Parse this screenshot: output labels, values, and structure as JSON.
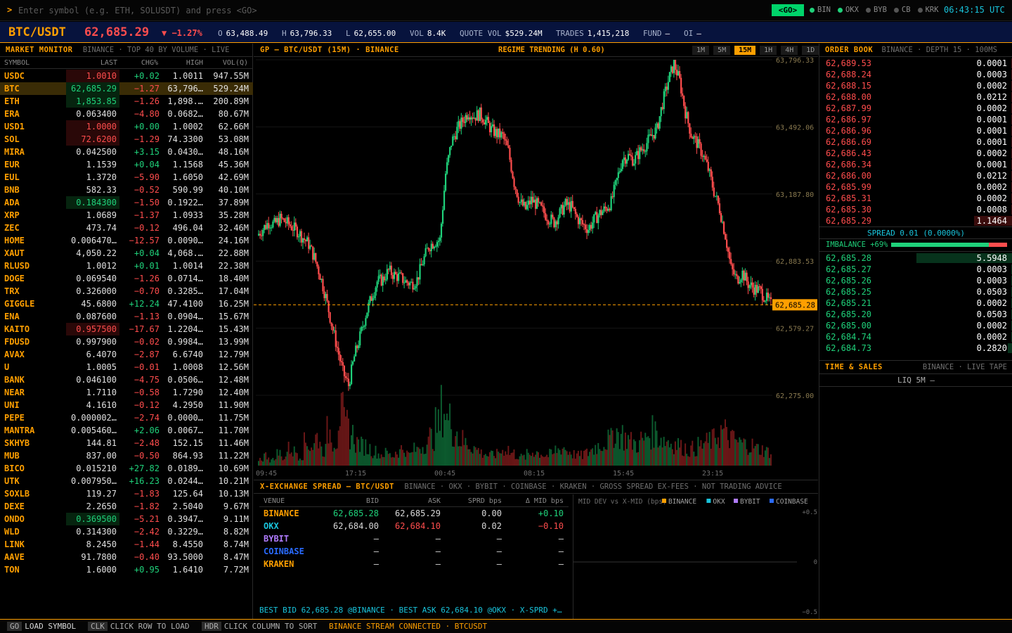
{
  "command": {
    "prompt": ">",
    "placeholder": "Enter symbol (e.g. ETH, SOLUSDT) and press <GO>",
    "go_label": "<GO>"
  },
  "exchanges": [
    {
      "code": "BIN",
      "color": "#1fd17a"
    },
    {
      "code": "OKX",
      "color": "#1fd17a"
    },
    {
      "code": "BYB",
      "color": "#555555"
    },
    {
      "code": "CB",
      "color": "#555555"
    },
    {
      "code": "KRK",
      "color": "#555555"
    }
  ],
  "clock": "06:43:15 UTC",
  "ticker": {
    "symbol": "BTC/USDT",
    "price": "62,685.29",
    "change": "▼ −1.27%",
    "open_label": "O",
    "open": "63,488.49",
    "high_label": "H",
    "high": "63,796.33",
    "low_label": "L",
    "low": "62,655.00",
    "vol_label": "VOL",
    "vol": "8.4K",
    "quote_vol_label": "QUOTE VOL",
    "quote_vol": "$529.24M",
    "trades_label": "TRADES",
    "trades": "1,415,218",
    "fund_label": "FUND",
    "fund": "—",
    "oi_label": "OI",
    "oi": "—"
  },
  "market_monitor": {
    "title": "MARKET MONITOR",
    "subtitle": "BINANCE · TOP 40 BY VOLUME · LIVE",
    "columns": [
      "SYMBOL",
      "LAST",
      "CHG%",
      "HIGH",
      "VOL(Q)"
    ],
    "rows": [
      {
        "sym": "USDC",
        "last": "1.0010",
        "chg": "+0.02",
        "high": "1.0011",
        "vol": "947.55M",
        "dir": "up",
        "flash": "dn"
      },
      {
        "sym": "BTC",
        "last": "62,685.29",
        "chg": "−1.27",
        "high": "63,796…",
        "vol": "529.24M",
        "dir": "dn",
        "flash": "up",
        "selected": true
      },
      {
        "sym": "ETH",
        "last": "1,853.85",
        "chg": "−1.26",
        "high": "1,898.…",
        "vol": "200.89M",
        "dir": "dn",
        "flash": "up"
      },
      {
        "sym": "ERA",
        "last": "0.063400",
        "chg": "−4.80",
        "high": "0.0682…",
        "vol": "80.67M",
        "dir": "dn",
        "flash": ""
      },
      {
        "sym": "USD1",
        "last": "1.0000",
        "chg": "+0.00",
        "high": "1.0002",
        "vol": "62.66M",
        "dir": "up",
        "flash": "dn"
      },
      {
        "sym": "SOL",
        "last": "72.6200",
        "chg": "−1.29",
        "high": "74.3300",
        "vol": "53.08M",
        "dir": "dn",
        "flash": "dn"
      },
      {
        "sym": "MIRA",
        "last": "0.042500",
        "chg": "+3.15",
        "high": "0.0430…",
        "vol": "48.16M",
        "dir": "up",
        "flash": ""
      },
      {
        "sym": "EUR",
        "last": "1.1539",
        "chg": "+0.04",
        "high": "1.1568",
        "vol": "45.36M",
        "dir": "up",
        "flash": ""
      },
      {
        "sym": "EUL",
        "last": "1.3720",
        "chg": "−5.90",
        "high": "1.6050",
        "vol": "42.69M",
        "dir": "dn",
        "flash": ""
      },
      {
        "sym": "BNB",
        "last": "582.33",
        "chg": "−0.52",
        "high": "590.99",
        "vol": "40.10M",
        "dir": "dn",
        "flash": ""
      },
      {
        "sym": "ADA",
        "last": "0.184300",
        "chg": "−1.50",
        "high": "0.1922…",
        "vol": "37.89M",
        "dir": "dn",
        "flash": "up"
      },
      {
        "sym": "XRP",
        "last": "1.0689",
        "chg": "−1.37",
        "high": "1.0933",
        "vol": "35.28M",
        "dir": "dn",
        "flash": ""
      },
      {
        "sym": "ZEC",
        "last": "473.74",
        "chg": "−0.12",
        "high": "496.04",
        "vol": "32.46M",
        "dir": "dn",
        "flash": ""
      },
      {
        "sym": "HOME",
        "last": "0.006470…",
        "chg": "−12.57",
        "high": "0.0090…",
        "vol": "24.16M",
        "dir": "dn",
        "flash": ""
      },
      {
        "sym": "XAUT",
        "last": "4,050.22",
        "chg": "+0.04",
        "high": "4,068.…",
        "vol": "22.88M",
        "dir": "up",
        "flash": ""
      },
      {
        "sym": "RLUSD",
        "last": "1.0012",
        "chg": "+0.01",
        "high": "1.0014",
        "vol": "22.38M",
        "dir": "up",
        "flash": ""
      },
      {
        "sym": "DOGE",
        "last": "0.069540",
        "chg": "−1.26",
        "high": "0.0714…",
        "vol": "18.40M",
        "dir": "dn",
        "flash": ""
      },
      {
        "sym": "TRX",
        "last": "0.326000",
        "chg": "−0.70",
        "high": "0.3285…",
        "vol": "17.04M",
        "dir": "dn",
        "flash": ""
      },
      {
        "sym": "GIGGLE",
        "last": "45.6800",
        "chg": "+12.24",
        "high": "47.4100",
        "vol": "16.25M",
        "dir": "up",
        "flash": ""
      },
      {
        "sym": "ENA",
        "last": "0.087600",
        "chg": "−1.13",
        "high": "0.0904…",
        "vol": "15.67M",
        "dir": "dn",
        "flash": ""
      },
      {
        "sym": "KAITO",
        "last": "0.957500",
        "chg": "−17.67",
        "high": "1.2204…",
        "vol": "15.43M",
        "dir": "dn",
        "flash": "dn"
      },
      {
        "sym": "FDUSD",
        "last": "0.997900",
        "chg": "−0.02",
        "high": "0.9984…",
        "vol": "13.99M",
        "dir": "dn",
        "flash": ""
      },
      {
        "sym": "AVAX",
        "last": "6.4070",
        "chg": "−2.87",
        "high": "6.6740",
        "vol": "12.79M",
        "dir": "dn",
        "flash": ""
      },
      {
        "sym": "U",
        "last": "1.0005",
        "chg": "−0.01",
        "high": "1.0008",
        "vol": "12.56M",
        "dir": "dn",
        "flash": ""
      },
      {
        "sym": "BANK",
        "last": "0.046100",
        "chg": "−4.75",
        "high": "0.0506…",
        "vol": "12.48M",
        "dir": "dn",
        "flash": ""
      },
      {
        "sym": "NEAR",
        "last": "1.7110",
        "chg": "−0.58",
        "high": "1.7290",
        "vol": "12.40M",
        "dir": "dn",
        "flash": ""
      },
      {
        "sym": "UNI",
        "last": "4.1610",
        "chg": "−0.12",
        "high": "4.2950",
        "vol": "11.90M",
        "dir": "dn",
        "flash": ""
      },
      {
        "sym": "PEPE",
        "last": "0.000002…",
        "chg": "−2.74",
        "high": "0.0000…",
        "vol": "11.75M",
        "dir": "dn",
        "flash": ""
      },
      {
        "sym": "MANTRA",
        "last": "0.005460…",
        "chg": "+2.06",
        "high": "0.0067…",
        "vol": "11.70M",
        "dir": "up",
        "flash": ""
      },
      {
        "sym": "SKHYB",
        "last": "144.81",
        "chg": "−2.48",
        "high": "152.15",
        "vol": "11.46M",
        "dir": "dn",
        "flash": ""
      },
      {
        "sym": "MUB",
        "last": "837.00",
        "chg": "−0.50",
        "high": "864.93",
        "vol": "11.22M",
        "dir": "dn",
        "flash": ""
      },
      {
        "sym": "BICO",
        "last": "0.015210",
        "chg": "+27.82",
        "high": "0.0189…",
        "vol": "10.69M",
        "dir": "up",
        "flash": ""
      },
      {
        "sym": "UTK",
        "last": "0.007950…",
        "chg": "+16.23",
        "high": "0.0244…",
        "vol": "10.21M",
        "dir": "up",
        "flash": ""
      },
      {
        "sym": "SOXLB",
        "last": "119.27",
        "chg": "−1.83",
        "high": "125.64",
        "vol": "10.13M",
        "dir": "dn",
        "flash": ""
      },
      {
        "sym": "DEXE",
        "last": "2.2650",
        "chg": "−1.82",
        "high": "2.5040",
        "vol": "9.67M",
        "dir": "dn",
        "flash": ""
      },
      {
        "sym": "ONDO",
        "last": "0.369500",
        "chg": "−5.21",
        "high": "0.3947…",
        "vol": "9.11M",
        "dir": "dn",
        "flash": "up"
      },
      {
        "sym": "WLD",
        "last": "0.314300",
        "chg": "−2.42",
        "high": "0.3229…",
        "vol": "8.82M",
        "dir": "dn",
        "flash": ""
      },
      {
        "sym": "LINK",
        "last": "8.2450",
        "chg": "−1.44",
        "high": "8.4550",
        "vol": "8.74M",
        "dir": "dn",
        "flash": ""
      },
      {
        "sym": "AAVE",
        "last": "91.7800",
        "chg": "−0.40",
        "high": "93.5000",
        "vol": "8.47M",
        "dir": "dn",
        "flash": ""
      },
      {
        "sym": "TON",
        "last": "1.6000",
        "chg": "+0.95",
        "high": "1.6410",
        "vol": "7.72M",
        "dir": "up",
        "flash": ""
      }
    ]
  },
  "chart_panel": {
    "title": "GP — BTC/USDT (15M) · BINANCE",
    "regime": "REGIME TRENDING (H 0.60)",
    "timeframes": [
      "1M",
      "5M",
      "15M",
      "1H",
      "4H",
      "1D"
    ],
    "active_timeframe": "15M"
  },
  "chart_data": {
    "type": "candlestick",
    "y_ticks": [
      "63,796.33",
      "63,492.06",
      "63,187.80",
      "62,883.53",
      "62,579.27",
      "62,275.00"
    ],
    "y_tick_values": [
      63796.33,
      63492.06,
      63187.8,
      62883.53,
      62579.27,
      62275.0
    ],
    "ylim": [
      62275.0,
      63796.33
    ],
    "x_ticks": [
      "09:45",
      "17:15",
      "00:45",
      "08:15",
      "15:45",
      "23:15"
    ],
    "last_price": 62685.28,
    "last_price_label": "62,685.28",
    "path": [
      63000,
      63030,
      63060,
      63050,
      63075,
      63060,
      63040,
      63020,
      62990,
      62960,
      62900,
      62820,
      62720,
      62600,
      62490,
      62380,
      62320,
      62450,
      62540,
      62640,
      62720,
      62790,
      62800,
      62840,
      62820,
      62810,
      62790,
      62780,
      62800,
      62880,
      62950,
      62970,
      62980,
      63280,
      63420,
      63480,
      63520,
      63560,
      63540,
      63550,
      63520,
      63480,
      63460,
      63450,
      63380,
      63240,
      63150,
      63120,
      63160,
      63140,
      63110,
      63080,
      63060,
      63100,
      63140,
      63130,
      63080,
      63050,
      63030,
      63070,
      63100,
      63120,
      63150,
      63250,
      63350,
      63360,
      63340,
      63380,
      63410,
      63450,
      63480,
      63600,
      63700,
      63780,
      63700,
      63560,
      63460,
      63420,
      63370,
      63300,
      63200,
      63120,
      63000,
      62850,
      62800,
      62830,
      62780,
      62760,
      62750,
      62720,
      62685
    ],
    "volume": [
      12,
      18,
      10,
      22,
      15,
      30,
      25,
      18,
      40,
      35,
      50,
      28,
      60,
      45,
      90,
      70,
      55,
      40,
      35,
      30,
      25,
      20,
      22,
      18,
      25,
      30,
      20,
      28,
      35,
      40,
      50,
      70,
      100,
      80,
      60,
      45,
      40,
      35,
      28,
      22,
      18,
      20,
      25,
      30,
      22,
      18,
      15,
      20,
      25,
      22,
      18,
      20,
      28,
      32,
      25,
      20,
      18,
      22,
      28,
      35,
      40,
      45,
      60,
      55,
      48,
      42,
      38,
      45,
      55,
      60,
      50,
      45,
      40,
      38,
      32,
      28,
      30,
      35,
      40,
      45,
      55,
      60,
      50,
      45,
      40,
      38,
      35,
      30,
      28,
      25,
      22
    ]
  },
  "spread_panel": {
    "title": "X-EXCHANGE SPREAD — BTC/USDT",
    "subtitle": "BINANCE · OKX · BYBIT · COINBASE · KRAKEN · GROSS SPREAD EX-FEES · NOT TRADING ADVICE",
    "columns": [
      "VENUE",
      "BID",
      "ASK",
      "SPRD bps",
      "Δ MID bps"
    ],
    "rows": [
      {
        "venue": "BINANCE",
        "bid": "62,685.28",
        "ask": "62,685.29",
        "spread": "0.00",
        "dmid": "+0.10",
        "color": "#ff9f00",
        "bid_cls": "up",
        "ask_cls": "neu",
        "dmid_cls": "up"
      },
      {
        "venue": "OKX",
        "bid": "62,684.00",
        "ask": "62,684.10",
        "spread": "0.02",
        "dmid": "−0.10",
        "color": "#19c4dc",
        "bid_cls": "neu",
        "ask_cls": "dn",
        "dmid_cls": "dn"
      },
      {
        "venue": "BYBIT",
        "bid": "—",
        "ask": "—",
        "spread": "—",
        "dmid": "—",
        "color": "#b07cff",
        "bid_cls": "neu",
        "ask_cls": "neu",
        "dmid_cls": "neu"
      },
      {
        "venue": "COINBASE",
        "bid": "—",
        "ask": "—",
        "spread": "—",
        "dmid": "—",
        "color": "#2a6bff",
        "bid_cls": "neu",
        "ask_cls": "neu",
        "dmid_cls": "neu"
      },
      {
        "venue": "KRAKEN",
        "bid": "—",
        "ask": "—",
        "spread": "—",
        "dmid": "—",
        "color": "#ff9f00",
        "bid_cls": "neu",
        "ask_cls": "neu",
        "dmid_cls": "neu"
      }
    ],
    "footer": "BEST BID 62,685.28 @BINANCE · BEST ASK 62,684.10 @OKX · X-SPRD +…",
    "mini_chart": {
      "title": "MID DEV vs X-MID (bps)",
      "legend": [
        {
          "name": "BINANCE",
          "color": "#ff9f00"
        },
        {
          "name": "OKX",
          "color": "#19c4dc"
        },
        {
          "name": "BYBIT",
          "color": "#b07cff"
        },
        {
          "name": "COINBASE",
          "color": "#2a6bff"
        }
      ],
      "y_ticks": [
        "+0.5",
        "0",
        "−0.5"
      ]
    }
  },
  "order_book": {
    "title": "ORDER BOOK",
    "subtitle": "BINANCE · DEPTH 15 · 100MS",
    "asks": [
      {
        "price": "62,689.53",
        "qty": "0.0001",
        "depth": 0.001
      },
      {
        "price": "62,688.24",
        "qty": "0.0003",
        "depth": 0.001
      },
      {
        "price": "62,688.15",
        "qty": "0.0002",
        "depth": 0.001
      },
      {
        "price": "62,688.00",
        "qty": "0.0212",
        "depth": 0.004
      },
      {
        "price": "62,687.99",
        "qty": "0.0002",
        "depth": 0.001
      },
      {
        "price": "62,686.97",
        "qty": "0.0001",
        "depth": 0.001
      },
      {
        "price": "62,686.96",
        "qty": "0.0001",
        "depth": 0.001
      },
      {
        "price": "62,686.69",
        "qty": "0.0001",
        "depth": 0.001
      },
      {
        "price": "62,686.43",
        "qty": "0.0002",
        "depth": 0.001
      },
      {
        "price": "62,686.34",
        "qty": "0.0001",
        "depth": 0.001
      },
      {
        "price": "62,686.00",
        "qty": "0.0212",
        "depth": 0.004
      },
      {
        "price": "62,685.99",
        "qty": "0.0002",
        "depth": 0.001
      },
      {
        "price": "62,685.31",
        "qty": "0.0002",
        "depth": 0.001
      },
      {
        "price": "62,685.30",
        "qty": "0.0008",
        "depth": 0.001
      },
      {
        "price": "62,685.29",
        "qty": "1.1464",
        "depth": 0.2
      }
    ],
    "spread": "SPREAD 0.01 (0.0000%)",
    "imbalance_label": "IMBALANCE +69%",
    "imbalance": 0.845,
    "bids": [
      {
        "price": "62,685.28",
        "qty": "5.5948",
        "depth": 1.0
      },
      {
        "price": "62,685.27",
        "qty": "0.0003",
        "depth": 0.001
      },
      {
        "price": "62,685.26",
        "qty": "0.0003",
        "depth": 0.001
      },
      {
        "price": "62,685.25",
        "qty": "0.0503",
        "depth": 0.009
      },
      {
        "price": "62,685.21",
        "qty": "0.0002",
        "depth": 0.001
      },
      {
        "price": "62,685.20",
        "qty": "0.0503",
        "depth": 0.009
      },
      {
        "price": "62,685.00",
        "qty": "0.0002",
        "depth": 0.001
      },
      {
        "price": "62,684.74",
        "qty": "0.0002",
        "depth": 0.001
      },
      {
        "price": "62,684.73",
        "qty": "0.2820",
        "depth": 0.05
      }
    ]
  },
  "time_sales": {
    "title": "TIME & SALES",
    "subtitle": "BINANCE · LIVE TAPE",
    "liq": "LIQ 5M —"
  },
  "status_bar": {
    "items": [
      {
        "key": "GO",
        "label": "LOAD SYMBOL"
      },
      {
        "key": "CLK",
        "label": "CLICK ROW TO LOAD"
      },
      {
        "key": "HDR",
        "label": "CLICK COLUMN TO SORT"
      }
    ],
    "stream": "BINANCE STREAM CONNECTED · BTCUSDT"
  }
}
